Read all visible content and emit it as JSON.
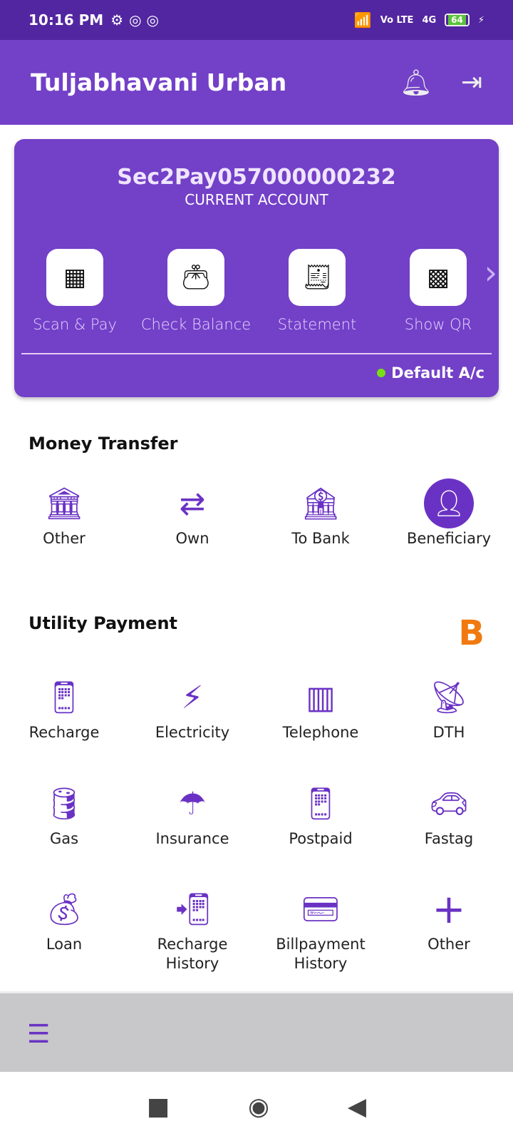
{
  "status_bar": {
    "time": "10:16 PM",
    "network": "4G",
    "volte": "Vo LTE",
    "battery": "64"
  },
  "app_bar": {
    "title": "Tuljabhavani Urban",
    "icons": [
      "bell-icon",
      "logout-icon"
    ]
  },
  "account_card": {
    "account_number": "Sec2Pay057000000232",
    "account_type": "CURRENT ACCOUNT",
    "actions": [
      {
        "label": "Scan & Pay",
        "icon": "scan-pay-icon"
      },
      {
        "label": "Check Balance",
        "icon": "wallet-icon"
      },
      {
        "label": "Statement",
        "icon": "statement-icon"
      },
      {
        "label": "Show QR",
        "icon": "qr-icon"
      }
    ],
    "default_label": "Default A/c",
    "default_color": "#77e012"
  },
  "money_transfer": {
    "title": "Money Transfer",
    "items": [
      {
        "label": "Other"
      },
      {
        "label": "Own"
      },
      {
        "label": "To Bank"
      },
      {
        "label": "Beneficiary"
      }
    ]
  },
  "utility_payment": {
    "title": "Utility Payment",
    "logo": "B",
    "items": [
      {
        "label": "Recharge"
      },
      {
        "label": "Electricity"
      },
      {
        "label": "Telephone"
      },
      {
        "label": "DTH"
      },
      {
        "label": "Gas"
      },
      {
        "label": "Insurance"
      },
      {
        "label": "Postpaid"
      },
      {
        "label": "Fastag"
      },
      {
        "label": "Loan"
      },
      {
        "label": "Recharge History"
      },
      {
        "label": "Billpayment History"
      },
      {
        "label": "Other"
      }
    ]
  },
  "colors": {
    "primary": "#7340c8",
    "status_bar": "#5226a0",
    "icon": "#6a32c4"
  }
}
